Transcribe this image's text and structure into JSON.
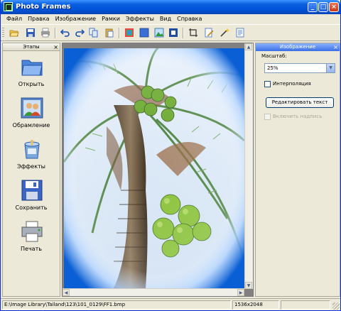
{
  "window": {
    "title": "Photo Frames",
    "controls": [
      "minimize",
      "maximize",
      "close"
    ]
  },
  "menu": [
    "Файл",
    "Правка",
    "Изображение",
    "Рамки",
    "Эффекты",
    "Вид",
    "Справка"
  ],
  "toolbar": {
    "buttons": [
      "open-folder-icon",
      "save-icon",
      "print-icon",
      "undo-icon",
      "redo-icon",
      "copy-icon",
      "paste-icon",
      "frame-icon",
      "color-icon",
      "image-icon",
      "fit-icon",
      "crop-icon",
      "edit-icon",
      "wand-icon",
      "document-icon"
    ]
  },
  "left_panel": {
    "title": "Этапы",
    "close": "×",
    "steps": [
      {
        "label": "Открыть",
        "icon": "folder-icon"
      },
      {
        "label": "Обрамление",
        "icon": "people-frame-icon"
      },
      {
        "label": "Эффекты",
        "icon": "effects-icon"
      },
      {
        "label": "Сохранить",
        "icon": "floppy-icon"
      },
      {
        "label": "Печать",
        "icon": "printer-icon"
      }
    ]
  },
  "right_panel": {
    "title": "Изображение",
    "close": "×",
    "zoom_label": "Масштаб:",
    "zoom_value": "25%",
    "interpolation_label": "Интерполяция",
    "interpolation_checked": false,
    "edit_text_button": "Редактировать текст",
    "enable_caption_label": "Включить надпись",
    "enable_caption_checked": false,
    "enable_caption_disabled": true
  },
  "status": {
    "path": "E:\\Image Library\\Tailand\\123\\101_0129\\FF1.bmp",
    "dimensions": "1536x2048"
  },
  "colors": {
    "titlebar": "#0a5fe0",
    "frame_blue": "#0b5fd4",
    "panel_bg": "#ece9d8"
  }
}
